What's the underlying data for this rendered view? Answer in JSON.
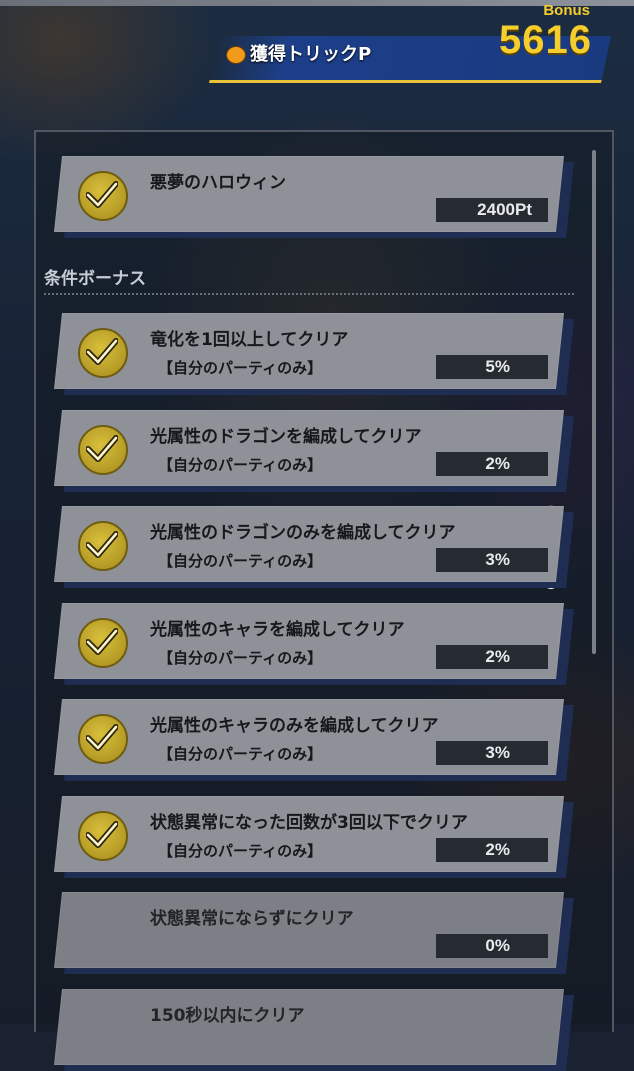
{
  "header": {
    "title": "獲得トリックP",
    "bonus_label": "Bonus",
    "bonus_value": "5616"
  },
  "main_quest": {
    "title": "悪夢のハロウィン",
    "value": "2400Pt",
    "checked": true
  },
  "section_label": "条件ボーナス",
  "conditions": [
    {
      "title": "竜化を1回以上してクリア",
      "sub": "【自分のパーティのみ】",
      "value": "5%",
      "checked": true
    },
    {
      "title": "光属性のドラゴンを編成してクリア",
      "sub": "【自分のパーティのみ】",
      "value": "2%",
      "checked": true
    },
    {
      "title": "光属性のドラゴンのみを編成してクリア",
      "sub": "【自分のパーティのみ】",
      "value": "3%",
      "checked": true
    },
    {
      "title": "光属性のキャラを編成してクリア",
      "sub": "【自分のパーティのみ】",
      "value": "2%",
      "checked": true
    },
    {
      "title": "光属性のキャラのみを編成してクリア",
      "sub": "【自分のパーティのみ】",
      "value": "3%",
      "checked": true
    },
    {
      "title": "状態異常になった回数が3回以下でクリア",
      "sub": "【自分のパーティのみ】",
      "value": "2%",
      "checked": true
    },
    {
      "title": "状態異常にならずにクリア",
      "sub": "",
      "value": "0%",
      "checked": false
    },
    {
      "title": "150秒以内にクリア",
      "sub": "",
      "value": "",
      "checked": false
    }
  ],
  "colors": {
    "accent_gold": "#f5cd2c",
    "card_gray": "#8e9197",
    "value_box": "#262a31"
  },
  "icons": {
    "header": "pumpkin-icon",
    "check": "checkmark-icon"
  }
}
